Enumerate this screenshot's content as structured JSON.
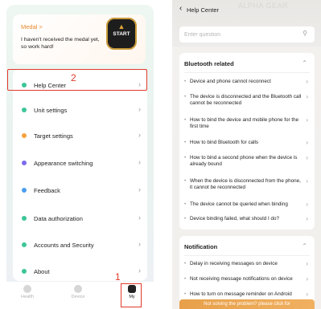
{
  "left_screen": {
    "medal": {
      "title": "Medal >",
      "description": "I haven't received the medal yet, so work hard!",
      "badge_text": "START",
      "badge_icon": "runner-icon"
    },
    "menu": [
      {
        "label": "Help Center",
        "color": "#3cc59a"
      },
      {
        "label": "Unit settings",
        "color": "#3cc59a"
      },
      {
        "label": "Target settings",
        "color": "#f5a23c"
      },
      {
        "label": "Appearance switching",
        "color": "#7b6cf0"
      },
      {
        "label": "Feedback",
        "color": "#4a9ef0"
      },
      {
        "label": "Data authorization",
        "color": "#3cc59a"
      },
      {
        "label": "Accounts and Security",
        "color": "#3cc59a"
      },
      {
        "label": "About",
        "color": "#3cc59a"
      }
    ],
    "annotations": {
      "step1": "1",
      "step2": "2"
    },
    "tabs": [
      {
        "label": "Health",
        "icon": "health-icon"
      },
      {
        "label": "Device",
        "icon": "device-icon"
      },
      {
        "label": "My",
        "icon": "person-icon"
      }
    ],
    "active_tab": "My"
  },
  "right_screen": {
    "title": "Help Center",
    "watermark": "ALPHA GEAR",
    "search_placeholder": "Enter question",
    "sections": [
      {
        "title": "Bluetooth related",
        "questions": [
          "Device and phone cannot reconnect",
          "The device is disconnected and the Bluetooth call cannot be reconnected",
          "How to bind the device and mobile phone for the first time",
          "How to bind Bluetooth for calls",
          "How to bind a second phone when the device is already bound",
          "When the device is disconnected from the phone, it cannot be reconnected",
          "The device cannot be queried when binding",
          "Device binding failed, what should I do?"
        ]
      },
      {
        "title": "Notification",
        "questions": [
          "Delay in receiving messages on device",
          "Not receiving message notifications on device",
          "How to turn on message reminder on Android"
        ]
      }
    ],
    "not_solved": "Not solving the problem? please click for"
  }
}
